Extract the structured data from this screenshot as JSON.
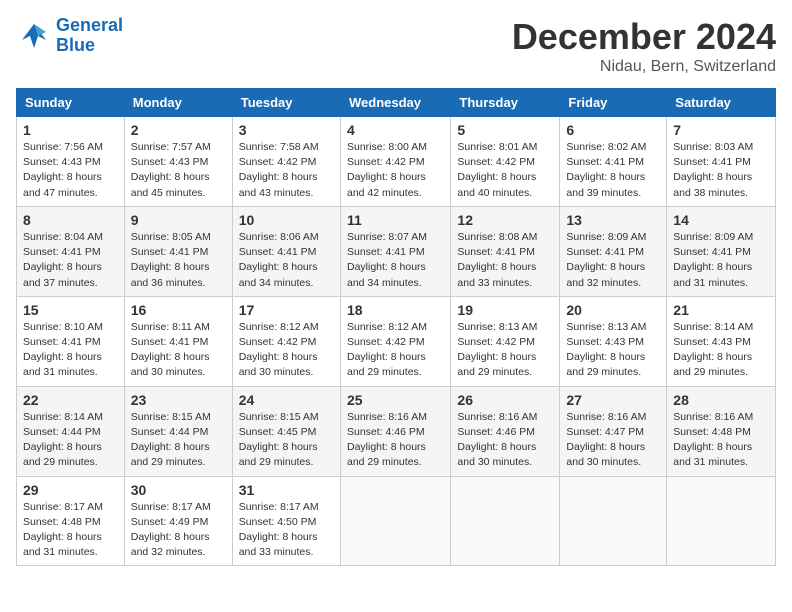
{
  "header": {
    "logo_line1": "General",
    "logo_line2": "Blue",
    "month": "December 2024",
    "location": "Nidau, Bern, Switzerland"
  },
  "days_of_week": [
    "Sunday",
    "Monday",
    "Tuesday",
    "Wednesday",
    "Thursday",
    "Friday",
    "Saturday"
  ],
  "weeks": [
    [
      {
        "day": "1",
        "sunrise": "7:56 AM",
        "sunset": "4:43 PM",
        "daylight": "8 hours and 47 minutes."
      },
      {
        "day": "2",
        "sunrise": "7:57 AM",
        "sunset": "4:43 PM",
        "daylight": "8 hours and 45 minutes."
      },
      {
        "day": "3",
        "sunrise": "7:58 AM",
        "sunset": "4:42 PM",
        "daylight": "8 hours and 43 minutes."
      },
      {
        "day": "4",
        "sunrise": "8:00 AM",
        "sunset": "4:42 PM",
        "daylight": "8 hours and 42 minutes."
      },
      {
        "day": "5",
        "sunrise": "8:01 AM",
        "sunset": "4:42 PM",
        "daylight": "8 hours and 40 minutes."
      },
      {
        "day": "6",
        "sunrise": "8:02 AM",
        "sunset": "4:41 PM",
        "daylight": "8 hours and 39 minutes."
      },
      {
        "day": "7",
        "sunrise": "8:03 AM",
        "sunset": "4:41 PM",
        "daylight": "8 hours and 38 minutes."
      }
    ],
    [
      {
        "day": "8",
        "sunrise": "8:04 AM",
        "sunset": "4:41 PM",
        "daylight": "8 hours and 37 minutes."
      },
      {
        "day": "9",
        "sunrise": "8:05 AM",
        "sunset": "4:41 PM",
        "daylight": "8 hours and 36 minutes."
      },
      {
        "day": "10",
        "sunrise": "8:06 AM",
        "sunset": "4:41 PM",
        "daylight": "8 hours and 34 minutes."
      },
      {
        "day": "11",
        "sunrise": "8:07 AM",
        "sunset": "4:41 PM",
        "daylight": "8 hours and 34 minutes."
      },
      {
        "day": "12",
        "sunrise": "8:08 AM",
        "sunset": "4:41 PM",
        "daylight": "8 hours and 33 minutes."
      },
      {
        "day": "13",
        "sunrise": "8:09 AM",
        "sunset": "4:41 PM",
        "daylight": "8 hours and 32 minutes."
      },
      {
        "day": "14",
        "sunrise": "8:09 AM",
        "sunset": "4:41 PM",
        "daylight": "8 hours and 31 minutes."
      }
    ],
    [
      {
        "day": "15",
        "sunrise": "8:10 AM",
        "sunset": "4:41 PM",
        "daylight": "8 hours and 31 minutes."
      },
      {
        "day": "16",
        "sunrise": "8:11 AM",
        "sunset": "4:41 PM",
        "daylight": "8 hours and 30 minutes."
      },
      {
        "day": "17",
        "sunrise": "8:12 AM",
        "sunset": "4:42 PM",
        "daylight": "8 hours and 30 minutes."
      },
      {
        "day": "18",
        "sunrise": "8:12 AM",
        "sunset": "4:42 PM",
        "daylight": "8 hours and 29 minutes."
      },
      {
        "day": "19",
        "sunrise": "8:13 AM",
        "sunset": "4:42 PM",
        "daylight": "8 hours and 29 minutes."
      },
      {
        "day": "20",
        "sunrise": "8:13 AM",
        "sunset": "4:43 PM",
        "daylight": "8 hours and 29 minutes."
      },
      {
        "day": "21",
        "sunrise": "8:14 AM",
        "sunset": "4:43 PM",
        "daylight": "8 hours and 29 minutes."
      }
    ],
    [
      {
        "day": "22",
        "sunrise": "8:14 AM",
        "sunset": "4:44 PM",
        "daylight": "8 hours and 29 minutes."
      },
      {
        "day": "23",
        "sunrise": "8:15 AM",
        "sunset": "4:44 PM",
        "daylight": "8 hours and 29 minutes."
      },
      {
        "day": "24",
        "sunrise": "8:15 AM",
        "sunset": "4:45 PM",
        "daylight": "8 hours and 29 minutes."
      },
      {
        "day": "25",
        "sunrise": "8:16 AM",
        "sunset": "4:46 PM",
        "daylight": "8 hours and 29 minutes."
      },
      {
        "day": "26",
        "sunrise": "8:16 AM",
        "sunset": "4:46 PM",
        "daylight": "8 hours and 30 minutes."
      },
      {
        "day": "27",
        "sunrise": "8:16 AM",
        "sunset": "4:47 PM",
        "daylight": "8 hours and 30 minutes."
      },
      {
        "day": "28",
        "sunrise": "8:16 AM",
        "sunset": "4:48 PM",
        "daylight": "8 hours and 31 minutes."
      }
    ],
    [
      {
        "day": "29",
        "sunrise": "8:17 AM",
        "sunset": "4:48 PM",
        "daylight": "8 hours and 31 minutes."
      },
      {
        "day": "30",
        "sunrise": "8:17 AM",
        "sunset": "4:49 PM",
        "daylight": "8 hours and 32 minutes."
      },
      {
        "day": "31",
        "sunrise": "8:17 AM",
        "sunset": "4:50 PM",
        "daylight": "8 hours and 33 minutes."
      },
      null,
      null,
      null,
      null
    ]
  ]
}
